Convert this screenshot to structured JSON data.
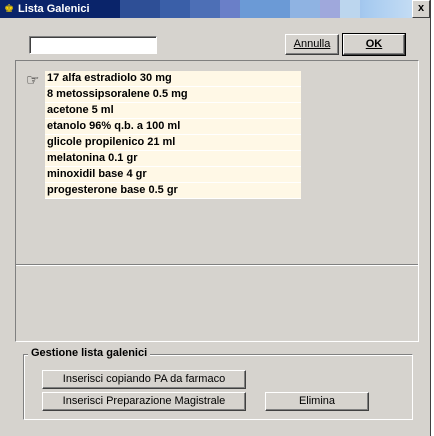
{
  "window": {
    "title": "Lista Galenici",
    "close_glyph": "x"
  },
  "search": {
    "value": ""
  },
  "buttons": {
    "annulla": "Annulla",
    "ok": "OK",
    "copia": "Inserisci copiando PA da farmaco",
    "magistrale": "Inserisci Preparazione Magistrale",
    "elimina": "Elimina"
  },
  "list": {
    "items": [
      "17 alfa estradiolo 30 mg",
      "8 metossipsoralene 0.5 mg",
      "acetone 5 ml",
      "etanolo 96% q.b. a 100 ml",
      "glicole propilenico 21 ml",
      "melatonina 0.1 gr",
      "minoxidil base 4 gr",
      "progesterone base 0.5 gr"
    ]
  },
  "group": {
    "legend": "Gestione lista galenici"
  },
  "colors": {
    "title_bar": "#0a246a",
    "item_bg": "#fff8e6",
    "face": "#d6d3ce"
  },
  "icons": {
    "pointer": "pointing-hand-icon",
    "app": "app-icon"
  }
}
